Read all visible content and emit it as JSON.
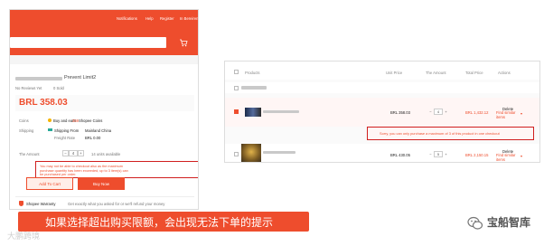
{
  "left_screen": {
    "topbar": {
      "notifications": "Notifications",
      "help": "Help",
      "register": "Register",
      "login": "In Bereiren"
    },
    "product_title_fragment": "Prevent Limit2",
    "reviews": "No Reviews Yet",
    "sold": "0 Sold",
    "price": "BRL 358.03",
    "coins": {
      "label": "Coins",
      "text_prefix": "Buy and earn",
      "coins_amount": "359",
      "text_suffix": "Shopee Coins"
    },
    "shipping": {
      "label": "Shipping",
      "from_label": "Shipping From",
      "from_value": "Mainland China",
      "rate_label": "Freight Rate",
      "rate_value": "BRL 0.00"
    },
    "amount": {
      "label": "The Amount",
      "qty": "4",
      "available": "14 units available"
    },
    "error_text": "You may not be able to checkout also as the maximum purchase quantity has been exceeded, up to 3 item(s) can be purchased per order.",
    "add_to_cart": "Add To Cart",
    "buy_now": "Buy Now",
    "guarantee": {
      "label": "Shopee Warranty",
      "text": "Get exactly what you asked for or we'll refund your money"
    }
  },
  "right_screen": {
    "headers": {
      "products": "Products",
      "unit_price": "Unit Price",
      "amount": "The Amount",
      "total_price": "Total Price",
      "actions": "Actions"
    },
    "rows": [
      {
        "unit_price": "BRL 358.03",
        "qty": "4",
        "total": "BRL 1,432.12",
        "delete": "Delete",
        "find_similar": "Find similar items"
      },
      {
        "unit_price": "BRL 430.05",
        "qty": "5",
        "total": "BRL 2,150.15",
        "delete": "Delete",
        "find_similar": "Find similar items"
      }
    ],
    "error_text": "Sorry, you can only purchase a maximum of 3 of this product in one checkout"
  },
  "banner": {
    "text": "如果选择超出购买限额，会出现无法下单的提示"
  },
  "watermark": "大鹏跨境",
  "brand": "宝船智库",
  "colors": {
    "accent": "#ee4d2d",
    "error_border": "#d01f1f"
  }
}
